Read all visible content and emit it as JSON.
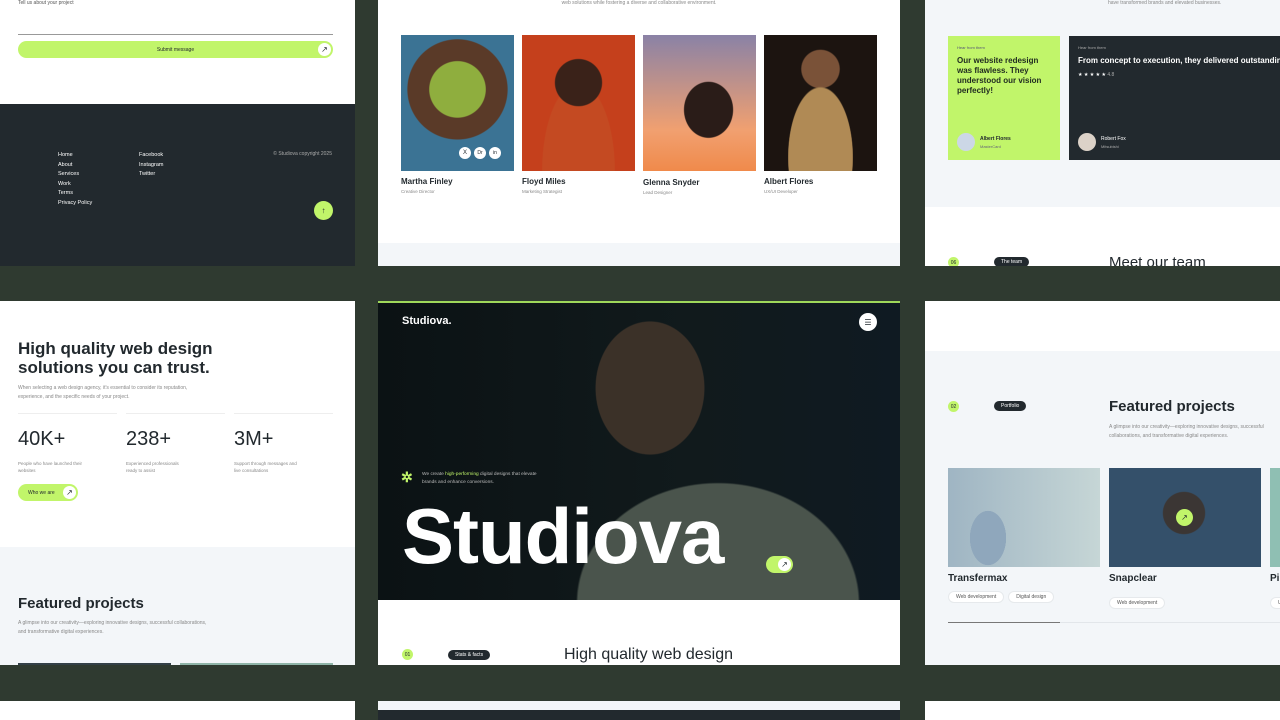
{
  "contact": {
    "field_label": "Tell us about your project",
    "submit_label": "Submit message"
  },
  "footer": {
    "links": [
      "Home",
      "About",
      "Services",
      "Work",
      "Terms",
      "Privacy Policy"
    ],
    "social": [
      "Facebook",
      "Instagram",
      "Twitter"
    ],
    "copyright": "© Studiova copyright 2025"
  },
  "team": {
    "intro": "web solutions while fostering a diverse and collaborative environment.",
    "members": [
      {
        "name": "Martha Finley",
        "role": "Creative Director"
      },
      {
        "name": "Floyd Miles",
        "role": "Marketing Strategist"
      },
      {
        "name": "Glenna Snyder",
        "role": "Lead Designer"
      },
      {
        "name": "Albert Flores",
        "role": "UX/UI Developer"
      }
    ],
    "social_icons": [
      "X",
      "Dr",
      "in"
    ],
    "section_num": "06",
    "section_tag": "The team",
    "heading": "Meet our team"
  },
  "testimonials": {
    "intro": "have transformed brands and elevated businesses.",
    "items": [
      {
        "label": "Hear from them",
        "quote": "Our website redesign was flawless. They understood our vision perfectly!",
        "name": "Albert Flores",
        "company": "MasterCard"
      },
      {
        "label": "Hear from them",
        "quote": "From concept to execution, they delivered outstanding results. Highly recommend their expertise!",
        "rating": "4.8",
        "stars": "★ ★ ★ ★ ★",
        "name": "Robert Fox",
        "company": "Mitsubishi"
      }
    ]
  },
  "stats": {
    "heading": "High quality web design solutions you can trust.",
    "description": "When selecting a web design agency, it's essential to consider its reputation, experience, and the specific needs of your project.",
    "items": [
      {
        "value": "40K+",
        "label": "People who have launched their websites"
      },
      {
        "value": "238+",
        "label": "Experienced professionals ready to assist"
      },
      {
        "value": "3M+",
        "label": "Support through messages and live consultations"
      }
    ],
    "button": "Who we are"
  },
  "featured": {
    "heading": "Featured projects",
    "description": "A glimpse into our creativity—exploring innovative designs, successful collaborations, and transformative digital experiences.",
    "section_num": "02",
    "section_tag": "Portfolio",
    "projects": [
      {
        "name": "Transfermax",
        "tags": [
          "Web development",
          "Digital design"
        ]
      },
      {
        "name": "Snapclear",
        "tags": [
          "Web development"
        ]
      },
      {
        "name": "Pi",
        "tags": [
          "U"
        ]
      }
    ]
  },
  "hero": {
    "logo": "Studiova.",
    "tagline_pre": "We create ",
    "tagline_highlight": "high-performing",
    "tagline_post": " digital designs that elevate brands and enhance conversions.",
    "title": "Studiova",
    "section_num": "01",
    "section_tag": "Stats & facts",
    "next_heading": "High quality web design"
  },
  "colors": {
    "accent": "#c1f56a",
    "dark": "#22292e",
    "bg": "#2f3a30"
  }
}
